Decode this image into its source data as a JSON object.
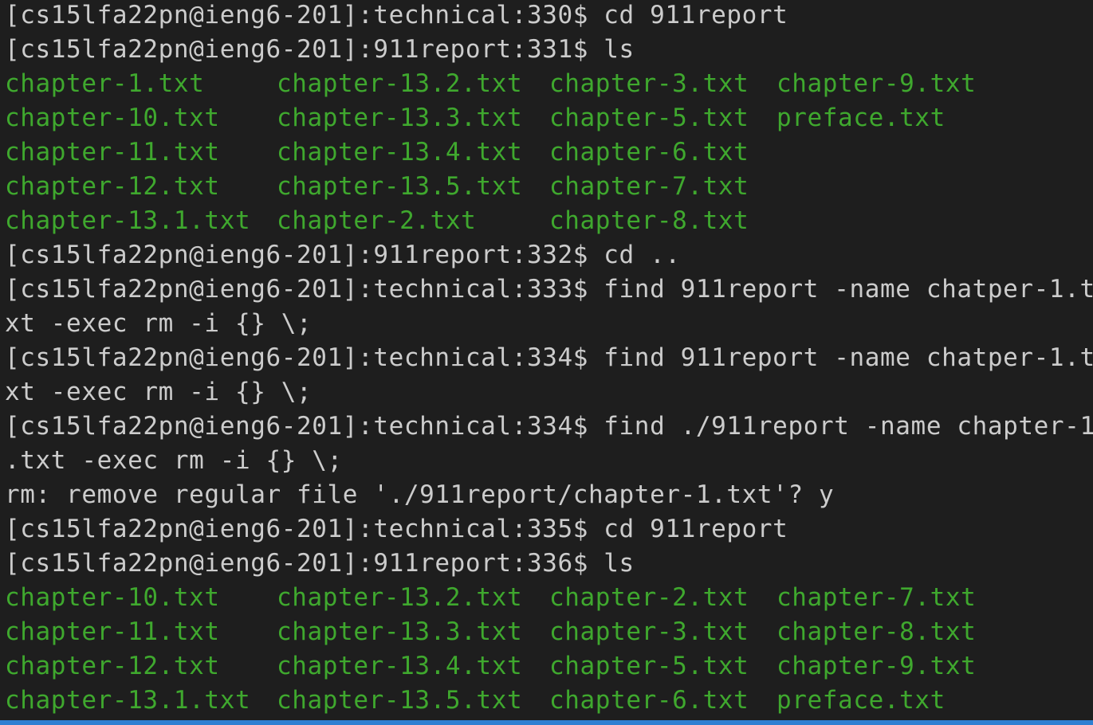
{
  "terminal": {
    "file_color": "#3fa82e",
    "text_color": "#cccccc",
    "background": "#1e1e1e",
    "statusbar_color": "#2f7fd2",
    "lines": [
      {
        "kind": "text",
        "text": "[cs15lfa22pn@ieng6-201]:technical:330$ cd 911report"
      },
      {
        "kind": "text",
        "text": "[cs15lfa22pn@ieng6-201]:911report:331$ ls"
      },
      {
        "kind": "ls",
        "cols": [
          "chapter-1.txt",
          "chapter-13.2.txt",
          "chapter-3.txt",
          "chapter-9.txt"
        ]
      },
      {
        "kind": "ls",
        "cols": [
          "chapter-10.txt",
          "chapter-13.3.txt",
          "chapter-5.txt",
          "preface.txt"
        ]
      },
      {
        "kind": "ls",
        "cols": [
          "chapter-11.txt",
          "chapter-13.4.txt",
          "chapter-6.txt",
          ""
        ]
      },
      {
        "kind": "ls",
        "cols": [
          "chapter-12.txt",
          "chapter-13.5.txt",
          "chapter-7.txt",
          ""
        ]
      },
      {
        "kind": "ls",
        "cols": [
          "chapter-13.1.txt",
          "chapter-2.txt",
          "chapter-8.txt",
          ""
        ]
      },
      {
        "kind": "text",
        "text": "[cs15lfa22pn@ieng6-201]:911report:332$ cd .."
      },
      {
        "kind": "text",
        "text": "[cs15lfa22pn@ieng6-201]:technical:333$ find 911report -name chatper-1.t"
      },
      {
        "kind": "text",
        "text": "xt -exec rm -i {} \\;"
      },
      {
        "kind": "text",
        "text": "[cs15lfa22pn@ieng6-201]:technical:334$ find 911report -name chatper-1.t"
      },
      {
        "kind": "text",
        "text": "xt -exec rm -i {} \\;"
      },
      {
        "kind": "text",
        "text": "[cs15lfa22pn@ieng6-201]:technical:334$ find ./911report -name chapter-1"
      },
      {
        "kind": "text",
        "text": ".txt -exec rm -i {} \\;"
      },
      {
        "kind": "text",
        "text": "rm: remove regular file './911report/chapter-1.txt'? y"
      },
      {
        "kind": "text",
        "text": "[cs15lfa22pn@ieng6-201]:technical:335$ cd 911report"
      },
      {
        "kind": "text",
        "text": "[cs15lfa22pn@ieng6-201]:911report:336$ ls"
      },
      {
        "kind": "ls",
        "cols": [
          "chapter-10.txt",
          "chapter-13.2.txt",
          "chapter-2.txt",
          "chapter-7.txt"
        ]
      },
      {
        "kind": "ls",
        "cols": [
          "chapter-11.txt",
          "chapter-13.3.txt",
          "chapter-3.txt",
          "chapter-8.txt"
        ]
      },
      {
        "kind": "ls",
        "cols": [
          "chapter-12.txt",
          "chapter-13.4.txt",
          "chapter-5.txt",
          "chapter-9.txt"
        ]
      },
      {
        "kind": "ls",
        "cols": [
          "chapter-13.1.txt",
          "chapter-13.5.txt",
          "chapter-6.txt",
          "preface.txt"
        ]
      }
    ]
  }
}
